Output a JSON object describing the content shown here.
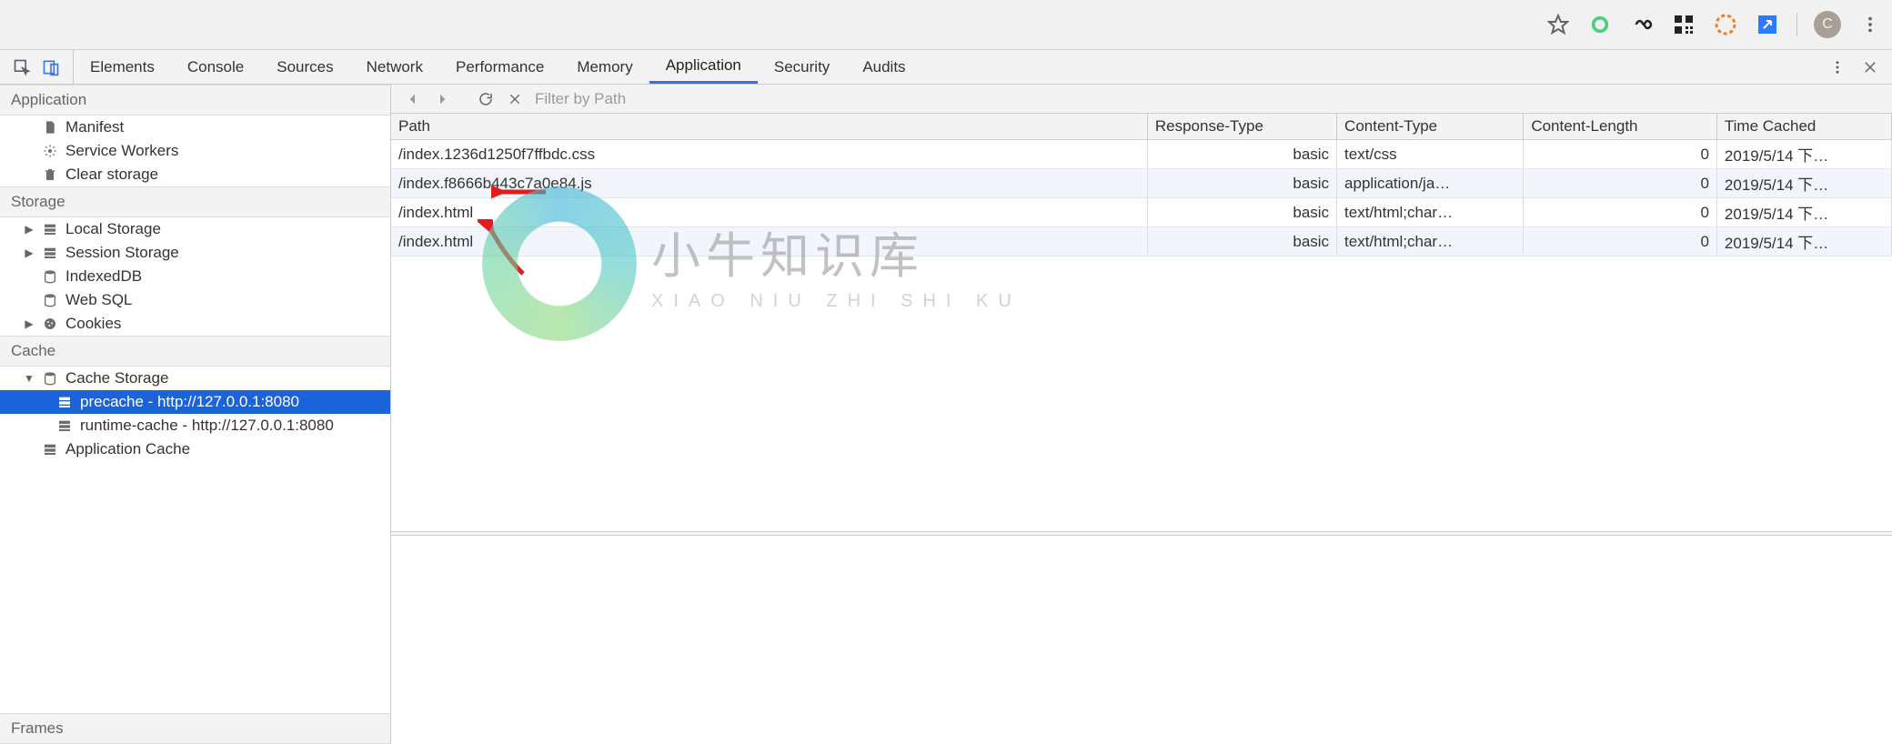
{
  "browser_toolbar": {
    "avatar_initial": "C"
  },
  "devtools": {
    "tabs": [
      "Elements",
      "Console",
      "Sources",
      "Network",
      "Performance",
      "Memory",
      "Application",
      "Security",
      "Audits"
    ],
    "active_tab": "Application"
  },
  "sidebar": {
    "groups": [
      {
        "title": "Application",
        "items": [
          {
            "icon": "file",
            "label": "Manifest"
          },
          {
            "icon": "gear",
            "label": "Service Workers"
          },
          {
            "icon": "trash",
            "label": "Clear storage"
          }
        ]
      },
      {
        "title": "Storage",
        "items": [
          {
            "icon": "grid",
            "label": "Local Storage",
            "expandable": true,
            "expanded": false
          },
          {
            "icon": "grid",
            "label": "Session Storage",
            "expandable": true,
            "expanded": false
          },
          {
            "icon": "db",
            "label": "IndexedDB"
          },
          {
            "icon": "db",
            "label": "Web SQL"
          },
          {
            "icon": "cookie",
            "label": "Cookies",
            "expandable": true,
            "expanded": false
          }
        ]
      },
      {
        "title": "Cache",
        "items": [
          {
            "icon": "db",
            "label": "Cache Storage",
            "expandable": true,
            "expanded": true,
            "children": [
              {
                "icon": "grid",
                "label": "precache - http://127.0.0.1:8080",
                "selected": true
              },
              {
                "icon": "grid",
                "label": "runtime-cache - http://127.0.0.1:8080"
              }
            ]
          },
          {
            "icon": "grid",
            "label": "Application Cache"
          }
        ]
      }
    ],
    "frames_title": "Frames"
  },
  "cache_toolbar": {
    "filter_placeholder": "Filter by Path"
  },
  "cache_table": {
    "headers": [
      "Path",
      "Response-Type",
      "Content-Type",
      "Content-Length",
      "Time Cached"
    ],
    "rows": [
      {
        "path": "/index.1236d1250f7ffbdc.css",
        "rt": "basic",
        "ct": "text/css",
        "cl": "0",
        "tc": "2019/5/14 下…"
      },
      {
        "path": "/index.f8666b443c7a0e84.js",
        "rt": "basic",
        "ct": "application/ja…",
        "cl": "0",
        "tc": "2019/5/14 下…"
      },
      {
        "path": "/index.html",
        "rt": "basic",
        "ct": "text/html;char…",
        "cl": "0",
        "tc": "2019/5/14 下…"
      },
      {
        "path": "/index.html",
        "rt": "basic",
        "ct": "text/html;char…",
        "cl": "0",
        "tc": "2019/5/14 下…"
      }
    ]
  },
  "watermark": {
    "cn": "小牛知识库",
    "pinyin": "XIAO NIU ZHI SHI KU"
  }
}
